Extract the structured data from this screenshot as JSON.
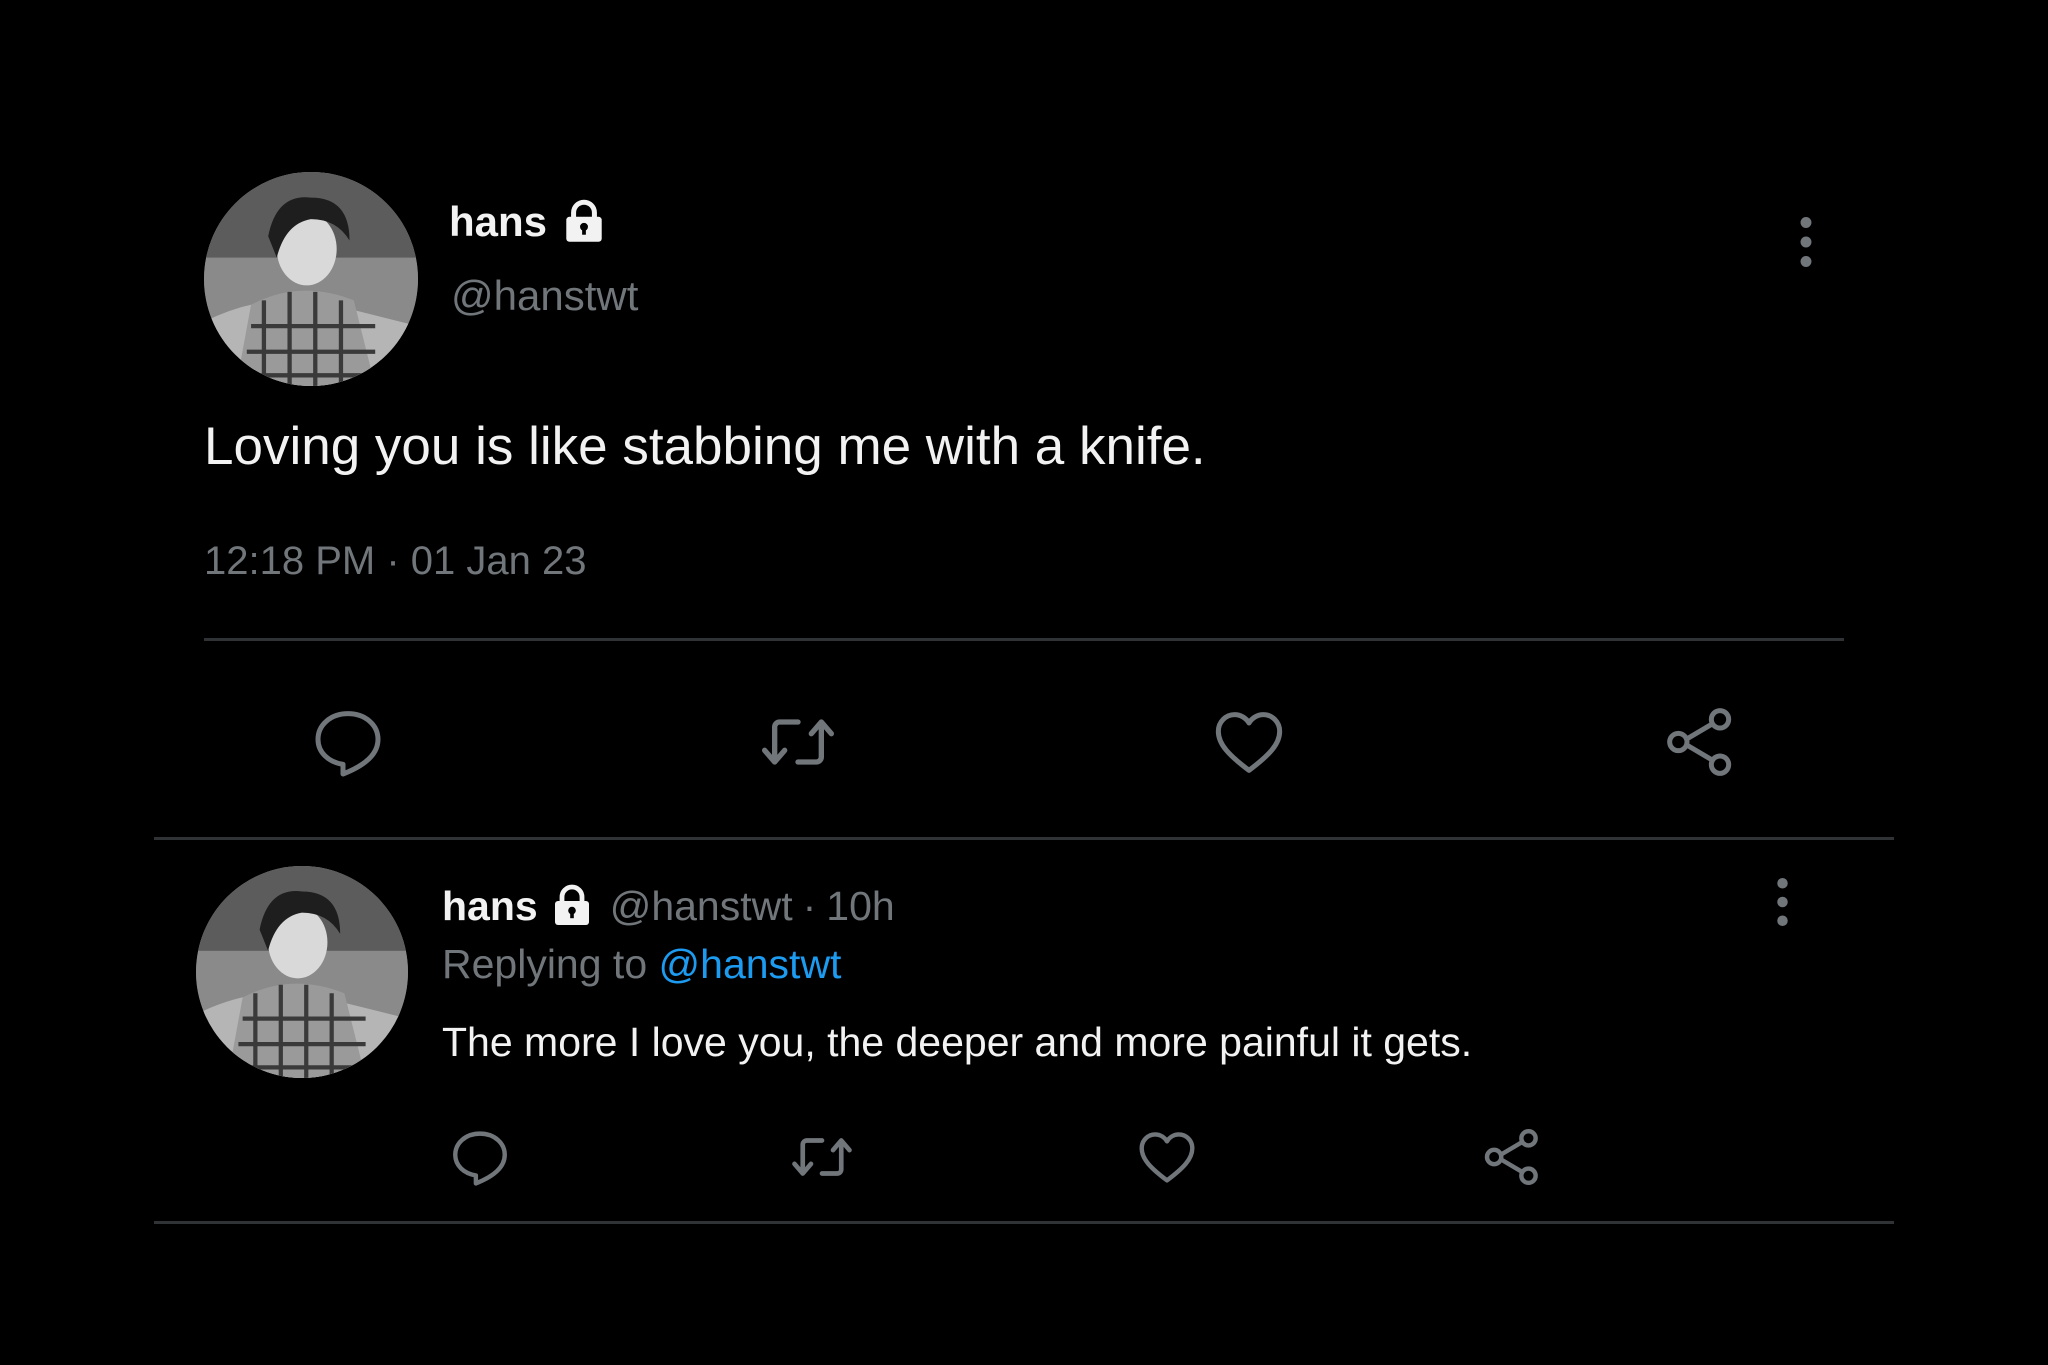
{
  "colors": {
    "background": "#000000",
    "primary_text": "#f2f2f2",
    "secondary_text": "#71767b",
    "icon": "#71767b",
    "divider": "#2f3336",
    "accent": "#1d9bf0"
  },
  "main_tweet": {
    "display_name": "hans",
    "handle": "@hanstwt",
    "text": "Loving you is like stabbing me with a knife.",
    "timestamp": "12:18 PM · 01 Jan 23",
    "icons": {
      "avatar": "profile-photo",
      "protected": "lock-icon",
      "more": "more-vertical-icon",
      "actions": [
        "reply-icon",
        "retweet-icon",
        "like-icon",
        "share-icon"
      ]
    }
  },
  "reply_tweet": {
    "display_name": "hans",
    "handle": "@hanstwt",
    "time_ago": "10h",
    "separator": "·",
    "replying_label": "Replying to",
    "replying_to": "@hanstwt",
    "text": "The more I love you, the deeper and more painful it gets.",
    "icons": {
      "avatar": "profile-photo",
      "protected": "lock-icon",
      "more": "more-vertical-icon",
      "actions": [
        "reply-icon",
        "retweet-icon",
        "like-icon",
        "share-icon"
      ]
    }
  }
}
